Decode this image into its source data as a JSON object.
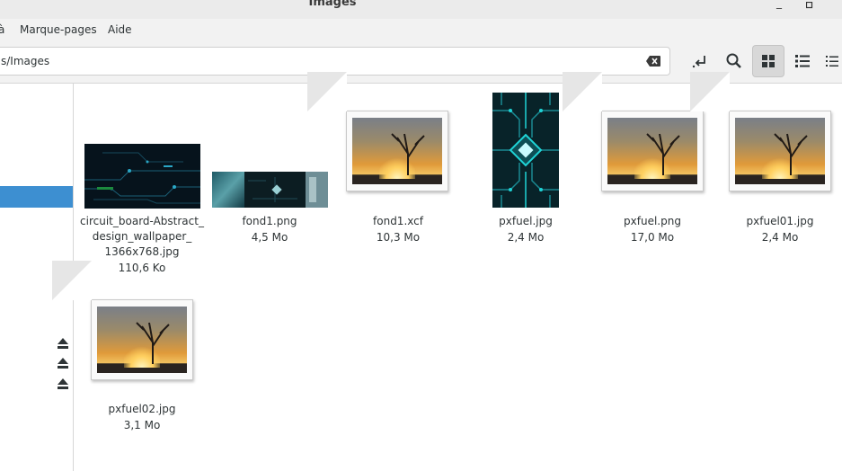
{
  "window": {
    "title": "Images"
  },
  "menu": [
    "à",
    "Marque-pages",
    "Aide"
  ],
  "location": {
    "path": "s/Images"
  },
  "files": [
    {
      "name_lines": [
        "circuit_board-Abstract_",
        "design_wallpaper_",
        "1366x768.jpg"
      ],
      "size": "110,6 Ko",
      "thumb": "circuit-wide"
    },
    {
      "name_lines": [
        "fond1.png"
      ],
      "size": "4,5 Mo",
      "thumb": "panorama"
    },
    {
      "name_lines": [
        "fond1.xcf"
      ],
      "size": "10,3 Mo",
      "thumb": "image-placeholder"
    },
    {
      "name_lines": [
        "pxfuel.jpg"
      ],
      "size": "2,4 Mo",
      "thumb": "circuit-tall"
    },
    {
      "name_lines": [
        "pxfuel.png"
      ],
      "size": "17,0 Mo",
      "thumb": "image-placeholder"
    },
    {
      "name_lines": [
        "pxfuel01.jpg"
      ],
      "size": "2,4 Mo",
      "thumb": "image-placeholder"
    },
    {
      "name_lines": [
        "pxfuel02.jpg"
      ],
      "size": "3,1 Mo",
      "thumb": "image-placeholder"
    }
  ],
  "colors": {
    "selection": "#3d8fd1",
    "toolbar_bg": "#f2f2f2",
    "circuit_accent": "#1fd3d6"
  },
  "icons": {
    "window_controls": [
      "minimize-icon",
      "maximize-icon"
    ],
    "toolbar": [
      "open-location-icon",
      "search-icon",
      "grid-view-icon",
      "list-view-icon",
      "compact-view-icon"
    ],
    "sidebar": [
      "eject-icon",
      "eject-icon",
      "eject-icon"
    ]
  }
}
